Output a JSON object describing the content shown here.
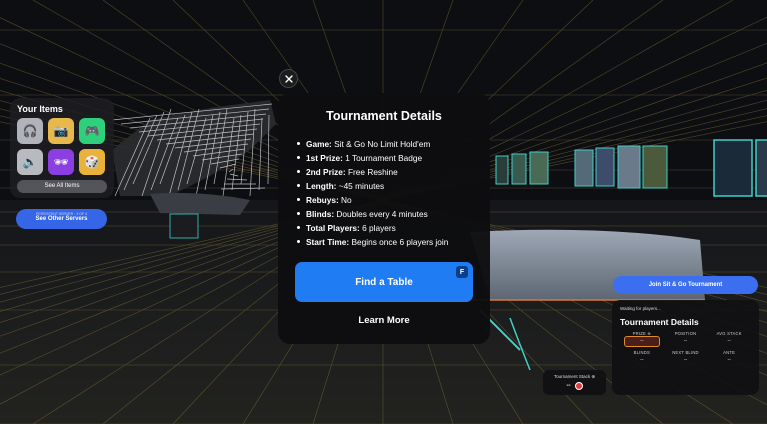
{
  "left_panel": {
    "title": "Your Items",
    "items": [
      {
        "icon": "headphones-icon",
        "color": "#b0b4ba"
      },
      {
        "icon": "camera-icon",
        "color": "#e7b84a"
      },
      {
        "icon": "gamepad-icon",
        "color": "#2fd07c"
      },
      {
        "icon": "speaker-icon",
        "color": "#b7bbc0"
      },
      {
        "icon": "sunglasses-icon",
        "color": "#8b3fe0"
      },
      {
        "icon": "dice-icon",
        "color": "#e9b23a"
      }
    ],
    "see_all_label": "See All Items"
  },
  "servers_button": {
    "sub_label": "PERSISTENT SERVER · 3 OF 4",
    "label": "See Other Servers"
  },
  "modal": {
    "title": "Tournament Details",
    "details": [
      {
        "key": "Game:",
        "value": " Sit & Go No Limit Hold'em"
      },
      {
        "key": "1st Prize:",
        "value": " 1 Tournament Badge"
      },
      {
        "key": "2nd Prize:",
        "value": " Free Reshine"
      },
      {
        "key": "Length:",
        "value": "  ~45 minutes"
      },
      {
        "key": "Rebuys:",
        "value": " No"
      },
      {
        "key": "Blinds:",
        "value": " Doubles every 4 minutes"
      },
      {
        "key": "Total Players:",
        "value": " 6 players"
      },
      {
        "key": "Start Time:",
        "value": " Begins once 6 players join"
      }
    ],
    "find_table_label": "Find a Table",
    "find_table_key": "F",
    "learn_more_label": "Learn More"
  },
  "join_button": {
    "label": "Join Sit & Go Tournament"
  },
  "tournament_panel": {
    "waiting": "Waiting for players...",
    "title": "Tournament Details",
    "stats": [
      {
        "label": "PRIZE ⊕",
        "value": "--",
        "active": true
      },
      {
        "label": "POSITION",
        "value": "--",
        "active": false
      },
      {
        "label": "AVG STACK",
        "value": "--",
        "active": false
      },
      {
        "label": "BLINDS",
        "value": "--",
        "active": false
      },
      {
        "label": "NEXT BLIND",
        "value": "--",
        "active": false
      },
      {
        "label": "ANTE",
        "value": "--",
        "active": false
      }
    ]
  },
  "stack_box": {
    "label": "Tournament Stack ⊕",
    "value": "--"
  },
  "colors": {
    "accent": "#1f7cf2",
    "grid_line": "#8a7a3a",
    "neon_teal": "#3fd0c8",
    "neon_orange": "#e07a30"
  }
}
